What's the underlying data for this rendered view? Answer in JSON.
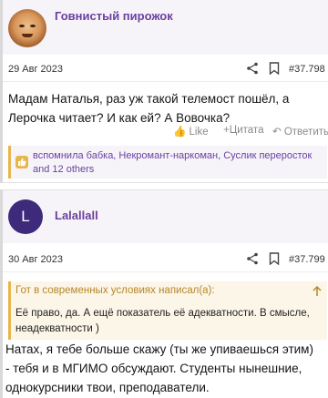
{
  "posts": [
    {
      "username": "Говнистый пирожок",
      "date": "29 Авг 2023",
      "post_number": "#37.798",
      "message": "Мадам Наталья, раз уж такой телемост пошёл, а Лерочка читает? И как ей? А Вовочка?",
      "actions": {
        "like": "Like",
        "quote": "+Цитата",
        "reply": "Ответить"
      },
      "likes_text": "вспомнила бабка, Некромант-наркоман, Суслик переросток and 12 others"
    },
    {
      "username": "Lalallall",
      "avatar_letter": "L",
      "date": "30 Авг 2023",
      "post_number": "#37.799",
      "quote_header": "Гот в современных условиях написал(а):",
      "quote_text": "Её право, да. А ещё показатель её адекватности. В смысле, неадекватности )",
      "message": "Натах, я тебе больше скажу (ты же упиваешься этим) - тебя и в МГИМО обсуждают. Студенты нынешние, однокурсники твои, преподаватели."
    }
  ],
  "colors": {
    "accent": "#6b3fa0",
    "quote_border": "#e7b64b",
    "header_bg": "#f6f4f9"
  }
}
